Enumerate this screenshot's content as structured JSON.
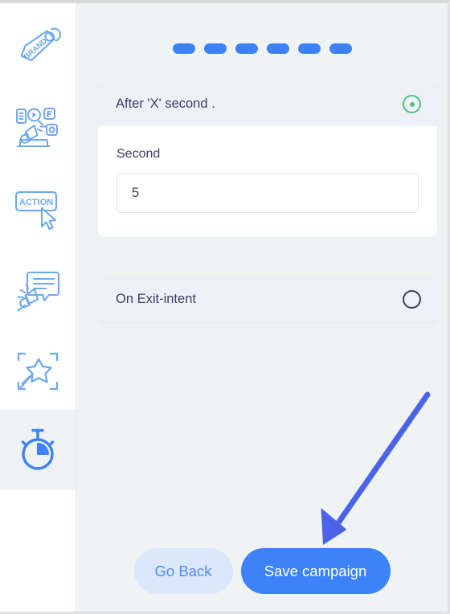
{
  "sidebar": {
    "items": [
      {
        "label": "Brand",
        "icon": "brand-tag-icon",
        "active": false
      },
      {
        "label": "Promotion",
        "icon": "social-megaphone-icon",
        "active": false
      },
      {
        "label": "Action",
        "icon": "action-cursor-icon",
        "active": false
      },
      {
        "label": "Message",
        "icon": "announcement-bubble-icon",
        "active": false
      },
      {
        "label": "Design",
        "icon": "magic-wand-icon",
        "active": false
      },
      {
        "label": "Timing",
        "icon": "stopwatch-icon",
        "active": true
      }
    ]
  },
  "stepper": {
    "total_steps": 6,
    "current_step": 6,
    "dots": [
      "1",
      "2",
      "3",
      "4",
      "5",
      "6"
    ]
  },
  "trigger_options": [
    {
      "id": "after-x-second",
      "title": "After 'X' second .",
      "selected": true,
      "radio_state": "selected",
      "field": {
        "label": "Second",
        "value": "5",
        "placeholder": "5"
      }
    },
    {
      "id": "on-exit-intent",
      "title": "On Exit-intent",
      "selected": false,
      "radio_state": "unselected"
    }
  ],
  "footer": {
    "back_label": "Go Back",
    "save_label": "Save campaign"
  },
  "colors": {
    "accent_blue": "#3d82f6",
    "secondary_blue_bg": "#dbe8fb",
    "secondary_blue_text": "#4f8df7",
    "radio_selected_green": "#4ec47f",
    "radio_unselected": "#3b3f55",
    "card_header_bg": "#eef0f8",
    "page_bg": "#eff3f4",
    "text_dark": "#3c3f63",
    "annotation_arrow": "#4a63e8"
  },
  "annotation": {
    "type": "arrow",
    "points_at": "save-campaign-button",
    "color": "#4a63e8"
  }
}
